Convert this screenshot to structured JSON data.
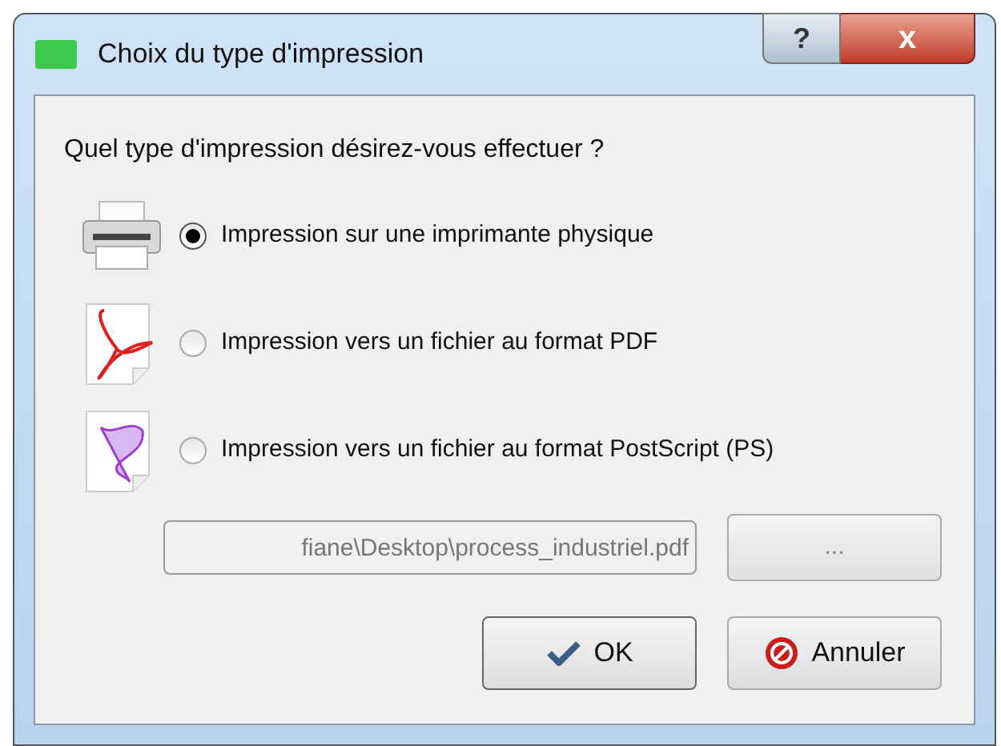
{
  "window": {
    "title": "Choix du type d'impression",
    "help_button": "?",
    "close_button": "x"
  },
  "prompt": "Quel type d'impression désirez-vous effectuer ?",
  "options": [
    {
      "kind": "printer",
      "label": "Impression sur une imprimante physique",
      "selected": true
    },
    {
      "kind": "pdf",
      "label": "Impression vers un fichier au format PDF",
      "selected": false
    },
    {
      "kind": "postscript",
      "label": "Impression vers un fichier au format PostScript (PS)",
      "selected": false
    }
  ],
  "file": {
    "value": "fiane\\Desktop\\process_industriel.pdf",
    "disabled": true
  },
  "browse": {
    "label": "...",
    "disabled": true
  },
  "buttons": [
    {
      "kind": "ok",
      "label": "OK"
    },
    {
      "kind": "cancel",
      "label": "Annuler"
    }
  ]
}
